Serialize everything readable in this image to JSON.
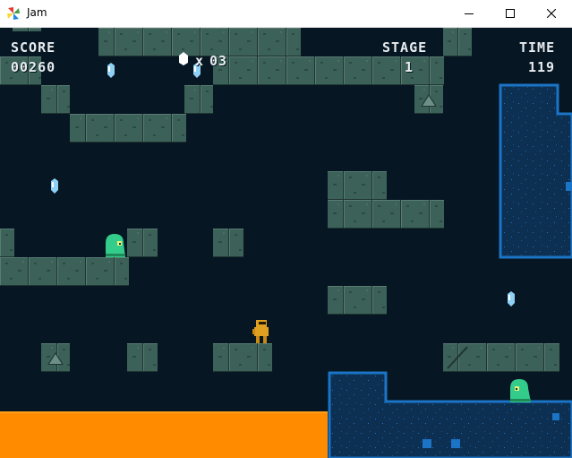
{
  "window": {
    "title": "Jam",
    "icon": "jam-app-icon",
    "controls": [
      "minimize-icon",
      "maximize-icon",
      "close-icon"
    ]
  },
  "hud": {
    "score_label": "SCORE",
    "score_value": "00260",
    "gem_multiplier": "x",
    "gem_count": "03",
    "stage_label": "STAGE",
    "stage_value": "1",
    "time_label": "TIME",
    "time_value": "119"
  },
  "colors": {
    "background": "#061623",
    "block": "#3c6158",
    "block_dark": "#263f3a",
    "lava": "#ff8c00",
    "water": "#0c2f52",
    "water_border": "#1b74c5",
    "slime": "#33cc8a",
    "player": "#e0a020",
    "gem": "#8fd0f5"
  }
}
